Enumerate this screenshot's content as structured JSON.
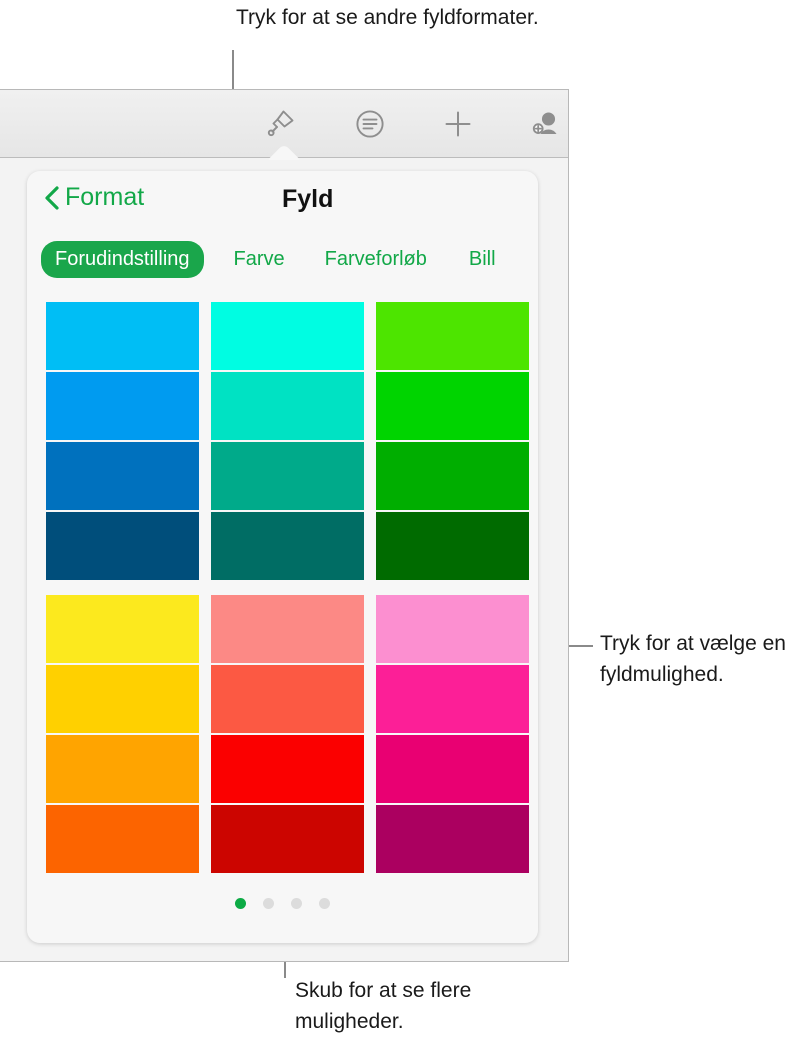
{
  "callouts": {
    "top": "Tryk for at se andre fyldformater.",
    "right": "Tryk for at vælge en fyldmulighed.",
    "bottom": "Skub for at se flere muligheder."
  },
  "toolbar": {
    "icons": [
      {
        "name": "paintbrush-icon",
        "label": "Format"
      },
      {
        "name": "paragraph-style-icon",
        "label": "Tekstformat"
      },
      {
        "name": "plus-icon",
        "label": "Indsæt"
      },
      {
        "name": "add-person-icon",
        "label": "Samarbejd"
      }
    ]
  },
  "popover": {
    "back_label": "Format",
    "title": "Fyld",
    "tabs": [
      {
        "label": "Forudindstilling",
        "selected": true
      },
      {
        "label": "Farve",
        "selected": false
      },
      {
        "label": "Farveforløb",
        "selected": false
      },
      {
        "label": "Bill",
        "selected": false
      }
    ],
    "accent_color": "#1aa64b",
    "link_color": "#12a848",
    "swatch_groups": [
      {
        "columns": [
          {
            "name": "blue",
            "colors": [
              "#00BEF5",
              "#009BF0",
              "#0071BE",
              "#004E7B"
            ]
          },
          {
            "name": "teal",
            "colors": [
              "#00FDE2",
              "#00E2C3",
              "#00AA8A",
              "#006D64"
            ]
          },
          {
            "name": "green",
            "colors": [
              "#4DE500",
              "#00D400",
              "#00AE00",
              "#006B00"
            ]
          }
        ]
      },
      {
        "columns": [
          {
            "name": "yellow-orange",
            "colors": [
              "#FCE91E",
              "#FFD000",
              "#FFA400",
              "#FC6400"
            ]
          },
          {
            "name": "red",
            "colors": [
              "#FC8985",
              "#FC5943",
              "#FB0000",
              "#CC0500"
            ]
          },
          {
            "name": "pink-magenta",
            "colors": [
              "#FC8FD0",
              "#FC1F97",
              "#E90072",
              "#AB0060"
            ]
          }
        ]
      }
    ],
    "page_dots": {
      "count": 4,
      "active_index": 0
    }
  }
}
